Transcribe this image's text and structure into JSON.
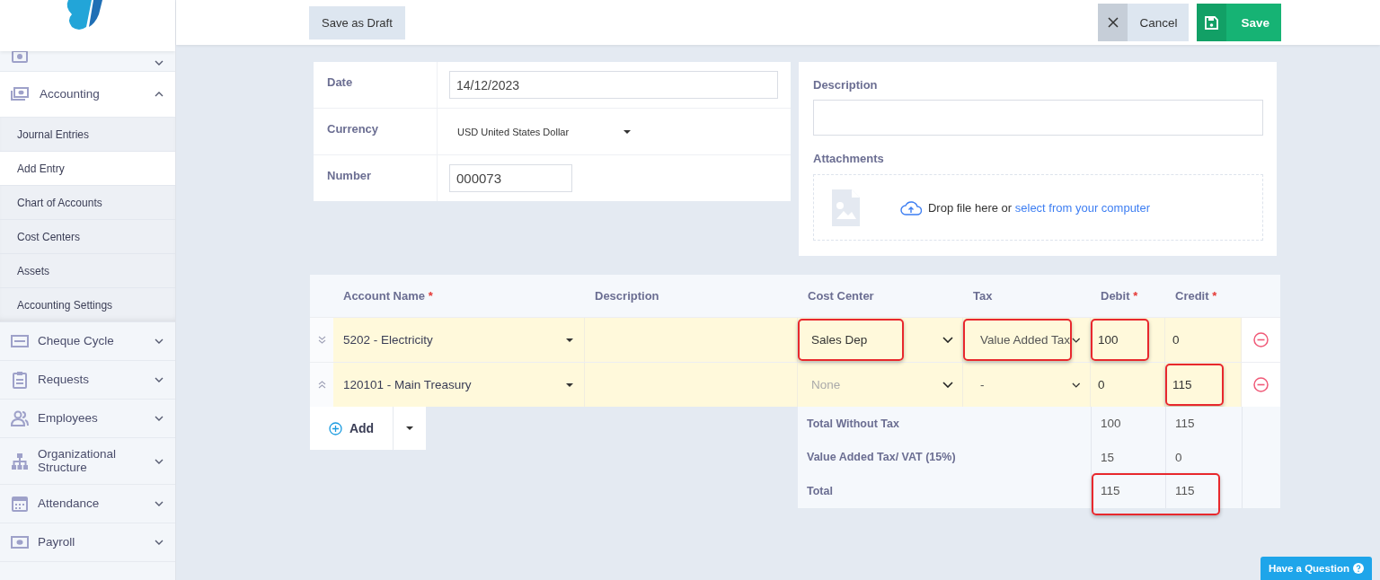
{
  "sidebar": {
    "items": [
      {
        "expanded": false
      },
      {
        "label": "Accounting",
        "expanded": true,
        "children": [
          {
            "label": "Journal Entries",
            "selected": false
          },
          {
            "label": "Add Entry",
            "selected": true
          },
          {
            "label": "Chart of Accounts",
            "selected": false
          },
          {
            "label": "Cost Centers",
            "selected": false
          },
          {
            "label": "Assets",
            "selected": false
          },
          {
            "label": "Accounting Settings",
            "selected": false
          }
        ]
      },
      {
        "label": "Cheque Cycle",
        "expanded": false
      },
      {
        "label": "Requests",
        "expanded": false
      },
      {
        "label": "Employees",
        "expanded": false
      },
      {
        "label": "Organizational Structure",
        "expanded": false
      },
      {
        "label": "Attendance",
        "expanded": false
      },
      {
        "label": "Payroll",
        "expanded": false
      }
    ]
  },
  "toolbar": {
    "draft_button": "Save as Draft",
    "cancel_button": "Cancel",
    "save_button": "Save"
  },
  "form": {
    "fields": [
      {
        "label": "Date",
        "kind": "input",
        "value": "14/12/2023"
      },
      {
        "label": "Currency",
        "kind": "select",
        "value": "USD United States Dollar"
      },
      {
        "label": "Number",
        "kind": "input",
        "value": "000073"
      }
    ],
    "description": {
      "label": "Description"
    },
    "attachments": {
      "label": "Attachments",
      "prompt": "Drop file here or",
      "link": "select from your computer"
    }
  },
  "table": {
    "columns": [
      {
        "label": "Account Name",
        "required_mark": "*"
      },
      {
        "label": "Description"
      },
      {
        "label": "Cost Center"
      },
      {
        "label": "Tax"
      },
      {
        "label": "Debit",
        "required_mark": "*"
      },
      {
        "label": "Credit",
        "required_mark": "*"
      }
    ],
    "rows": [
      {
        "account": "5202 - Electricity",
        "cost_center": {
          "value": "Sales Dep",
          "highlighted": true
        },
        "tax": {
          "value": "Value Added Tax",
          "highlighted": true
        },
        "debit": {
          "value": "100",
          "highlighted": true
        },
        "credit": {
          "value": "0",
          "highlighted": false
        }
      },
      {
        "account": "120101 - Main Treasury",
        "cost_center": {
          "placeholder": "None",
          "highlighted": false
        },
        "tax": {
          "value": "-",
          "highlighted": false
        },
        "debit": {
          "value": "0",
          "highlighted": false
        },
        "credit": {
          "value": "115",
          "highlighted": true
        }
      }
    ],
    "add_button": "Add",
    "totals": [
      {
        "label": "Total Without Tax",
        "debit": "100",
        "credit": "115",
        "highlighted": false
      },
      {
        "label": "Value Added Tax/ VAT (15%)",
        "debit": "15",
        "credit": "0",
        "highlighted": false
      },
      {
        "label": "Total",
        "debit": "115",
        "credit": "115",
        "highlighted": true
      }
    ]
  },
  "help_button": "Have a Question"
}
